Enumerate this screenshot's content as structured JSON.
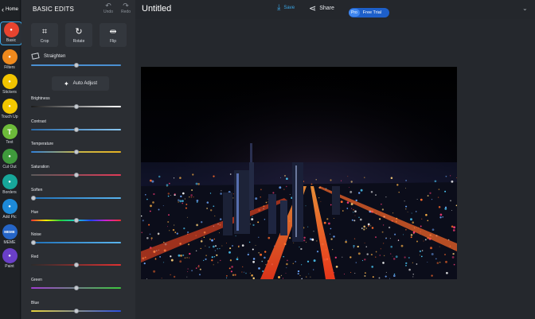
{
  "rail": {
    "home_label": "Home",
    "items": [
      {
        "label": "Basic",
        "icon": "sliders-icon",
        "color": "#e8442f"
      },
      {
        "label": "Filters",
        "icon": "wand-icon",
        "color": "#f08a1d"
      },
      {
        "label": "Stickers",
        "icon": "cloud-icon",
        "color": "#f2c400"
      },
      {
        "label": "Touch Up",
        "icon": "face-icon",
        "color": "#f4c800"
      },
      {
        "label": "Text",
        "icon": "text-icon",
        "glyph": "T",
        "color": "#6dbb3a"
      },
      {
        "label": "Cut Out",
        "icon": "person-icon",
        "color": "#3f9a3c"
      },
      {
        "label": "Borders",
        "icon": "border-icon",
        "color": "#17a79a"
      },
      {
        "label": "Add Pic",
        "icon": "add-photo-icon",
        "color": "#1d8ad8"
      },
      {
        "label": "MEME",
        "icon": "meme-icon",
        "glyph": "MEME",
        "color": "#2565c7"
      },
      {
        "label": "Paint",
        "icon": "brush-icon",
        "color": "#6a3fc8"
      }
    ]
  },
  "panel": {
    "title": "BASIC EDITS",
    "undo": "Undo",
    "redo": "Redo",
    "tools": [
      {
        "label": "Crop",
        "icon": "crop-icon"
      },
      {
        "label": "Rotate",
        "icon": "rotate-icon"
      },
      {
        "label": "Flip",
        "icon": "flip-icon"
      }
    ],
    "straighten": "Straighten",
    "auto_adjust": "Auto Adjust",
    "sliders": [
      {
        "label": "Brightness",
        "value": 0.5,
        "gradient": "linear-gradient(90deg,#1b1b1b,#ffffff)"
      },
      {
        "label": "Contrast",
        "value": 0.5,
        "gradient": "linear-gradient(90deg,#2a6aa8,#8cc7f0)"
      },
      {
        "label": "Temperature",
        "value": 0.5,
        "gradient": "linear-gradient(90deg,#2f7fd8,#c7b64a,#e6b221)"
      },
      {
        "label": "Saturation",
        "value": 0.5,
        "gradient": "linear-gradient(90deg,#5a5a5a,#e23a57)"
      },
      {
        "label": "Soften",
        "value": 0.03,
        "gradient": "linear-gradient(90deg,#1e6fb7,#59b3ee)"
      },
      {
        "label": "Hue",
        "value": 0.5,
        "gradient": "linear-gradient(90deg,#ff3030,#f6f000,#20d040,#20d0d0,#2040ff,#d020d0,#ff3030)"
      },
      {
        "label": "Noise",
        "value": 0.03,
        "gradient": "linear-gradient(90deg,#1f6fb6,#5bb5ee)"
      },
      {
        "label": "Red",
        "value": 0.5,
        "gradient": "linear-gradient(90deg,#2c2c2c,#e03131)"
      },
      {
        "label": "Green",
        "value": 0.5,
        "gradient": "linear-gradient(90deg,#a03cd0,#3cc83c)"
      },
      {
        "label": "Blue",
        "value": 0.5,
        "gradient": "linear-gradient(90deg,#e6d23a,#2a4ee0)"
      }
    ]
  },
  "topbar": {
    "doc_title": "Untitled",
    "save": "Save",
    "share": "Share",
    "pro": "Pro",
    "free_trial": "Free Trial"
  },
  "colors": {
    "accent": "#3aa6e6"
  }
}
